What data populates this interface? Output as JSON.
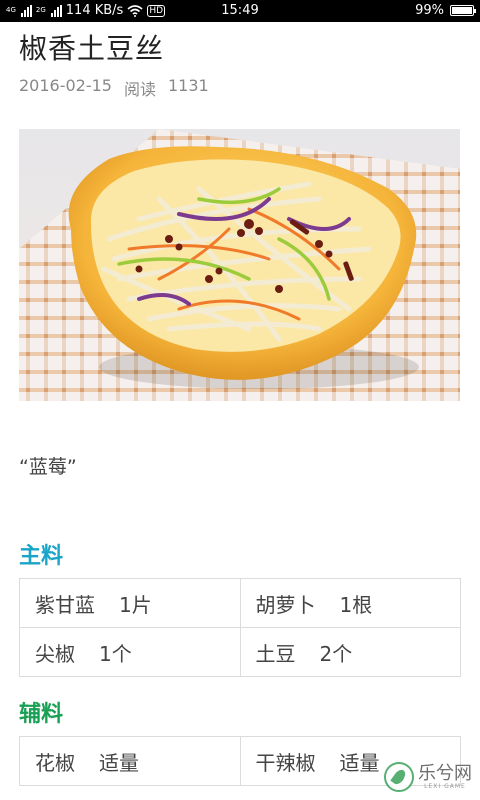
{
  "status_bar": {
    "network_speed": "114 KB/s",
    "signal_tag_1": "4G",
    "signal_tag_2": "2G",
    "hd_label": "HD",
    "time": "15:49",
    "battery_percent": "99%",
    "battery_level": 0.99
  },
  "article": {
    "title": "椒香土豆丝",
    "date": "2016-02-15",
    "read_label": "阅读",
    "read_count": "1131",
    "quote": "“蓝莓”"
  },
  "main_ingredients": {
    "heading": "主料",
    "rows": [
      [
        {
          "name": "紫甘蓝",
          "qty": "1片"
        },
        {
          "name": "胡萝卜",
          "qty": "1根"
        }
      ],
      [
        {
          "name": "尖椒",
          "qty": "1个"
        },
        {
          "name": "土豆",
          "qty": "2个"
        }
      ]
    ]
  },
  "aux_ingredients": {
    "heading": "辅料",
    "rows": [
      [
        {
          "name": "花椒",
          "qty": "适量"
        },
        {
          "name": "干辣椒",
          "qty": "适量"
        }
      ]
    ]
  },
  "watermark": {
    "text": "乐兮网",
    "sub": "LEXI GAME"
  }
}
